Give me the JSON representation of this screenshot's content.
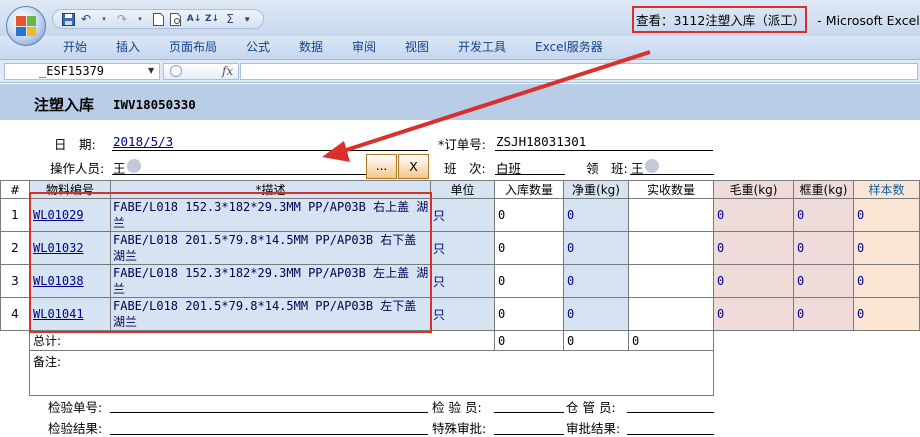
{
  "window": {
    "title": "查看：3112注塑入库（派工）",
    "app_suffix": "- Microsoft Excel"
  },
  "ribbon_tabs": [
    "开始",
    "插入",
    "页面布局",
    "公式",
    "数据",
    "审阅",
    "视图",
    "开发工具",
    "Excel服务器"
  ],
  "formula_bar": {
    "name_box": "_ESF15379",
    "fx": "fx",
    "formula": ""
  },
  "sheet": {
    "title": "注塑入库",
    "doc_no": "IWV18050330",
    "date_label": "日　期:",
    "date_value": "2018/5/3",
    "order_label": "*订单号:",
    "order_value": "ZSJH18031301",
    "operator_label": "操作人员:",
    "operator_value": "王",
    "dots_button": "...",
    "close_button": "X",
    "shift_label": "班　次:",
    "shift_value": "白班",
    "leader_label": "领　班:",
    "leader_value": "王",
    "columns": [
      "#",
      "物料编号",
      "*描述",
      "单位",
      "入库数量",
      "净重(kg)",
      "实收数量",
      "毛重(kg)",
      "框重(kg)",
      "样本数"
    ],
    "rows": [
      {
        "idx": "1",
        "code": "WL01029",
        "desc": "FABE/L018 152.3*182*29.3MM PP/AP03B 右上盖 湖兰",
        "unit": "只",
        "qty": "0",
        "net": "0",
        "recv": "",
        "gross": "0",
        "tare": "0",
        "sample": "0"
      },
      {
        "idx": "2",
        "code": "WL01032",
        "desc": "FABE/L018 201.5*79.8*14.5MM PP/AP03B 右下盖 湖兰",
        "unit": "只",
        "qty": "0",
        "net": "0",
        "recv": "",
        "gross": "0",
        "tare": "0",
        "sample": "0"
      },
      {
        "idx": "3",
        "code": "WL01038",
        "desc": "FABE/L018 152.3*182*29.3MM PP/AP03B 左上盖 湖兰",
        "unit": "只",
        "qty": "0",
        "net": "0",
        "recv": "",
        "gross": "0",
        "tare": "0",
        "sample": "0"
      },
      {
        "idx": "4",
        "code": "WL01041",
        "desc": "FABE/L018 201.5*79.8*14.5MM PP/AP03B 左下盖 湖兰",
        "unit": "只",
        "qty": "0",
        "net": "0",
        "recv": "",
        "gross": "0",
        "tare": "0",
        "sample": "0"
      }
    ],
    "total_label": "总计:",
    "total_qty": "0",
    "total_net": "0",
    "total_recv": "0",
    "remark_label": "备注:",
    "inspect_no_label": "检验单号:",
    "inspector_label": "检 验 员:",
    "warehouse_label": "仓 管 员:",
    "inspect_result_label": "检验结果:",
    "special_label": "特殊审批:",
    "approval_label": "审批结果:"
  },
  "colors": {
    "highlight_red": "#d9302c",
    "header_band": "#b9cde6",
    "cell_blue": "#d6e3f2",
    "cell_pink": "#f0dbdb",
    "cell_peach": "#fbe6d6"
  }
}
